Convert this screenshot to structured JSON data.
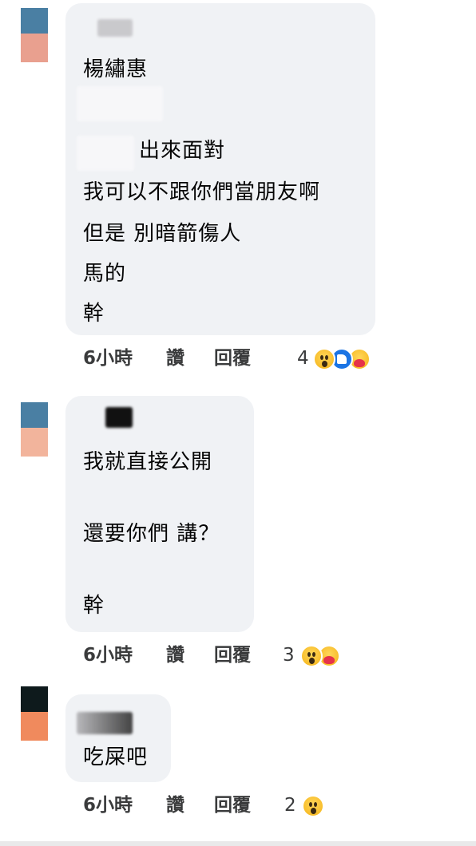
{
  "comments": [
    {
      "lines": [
        "楊繡惠",
        "出來面對",
        "我可以不跟你們當朋友啊",
        "但是 別暗箭傷人",
        "馬的",
        "幹"
      ],
      "time": "6小時",
      "like": "讚",
      "reply": "回覆",
      "reaction_count": "4",
      "reactions": [
        "wow-icon",
        "like-icon",
        "care-icon"
      ],
      "avatar_colors": [
        "#4a7fa3",
        "#e9a08f"
      ]
    },
    {
      "lines": [
        "我就直接公開",
        "還要你們 講？",
        "幹"
      ],
      "time": "6小時",
      "like": "讚",
      "reply": "回覆",
      "reaction_count": "3",
      "reactions": [
        "wow-icon",
        "care-icon"
      ],
      "avatar_colors": [
        "#4a7fa3",
        "#f2b49c"
      ]
    },
    {
      "lines": [
        "吃屎吧"
      ],
      "time": "6小時",
      "like": "讚",
      "reply": "回覆",
      "reaction_count": "2",
      "reactions": [
        "wow-icon"
      ],
      "avatar_colors": [
        "#0e1a1c",
        "#f08a5d"
      ]
    }
  ]
}
